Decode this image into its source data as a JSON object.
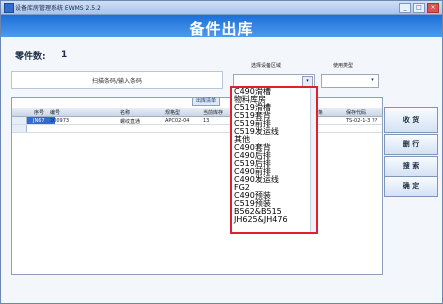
{
  "window": {
    "title": "设备库房管理系统 EWMS 2.5.2",
    "buttons": [
      "_",
      "□",
      "×"
    ]
  },
  "banner": {
    "heading": "备件出库"
  },
  "summary": {
    "label": "零件数:",
    "value": "1"
  },
  "scan": {
    "placeholder": "扫描条码/输入条码"
  },
  "location": {
    "label": "选择设备区域",
    "selected": ""
  },
  "usage_type": {
    "label": "使用类型",
    "selected": ""
  },
  "grid": {
    "tab_label": "出库清单",
    "columns": [
      "序号",
      "编号",
      "名称",
      "规格型",
      "当前库存",
      "条",
      "保存代码"
    ],
    "rows": [
      {
        "index": "JN67",
        "code": "200973",
        "name": "螺纹直通",
        "spec": "APC02-04",
        "stock": "13",
        "code_extra": "TS-02-1-3 ??"
      }
    ]
  },
  "actions": {
    "receive": "收 货",
    "delete": "删 行",
    "search": "搜 索",
    "confirm": "确 定"
  },
  "dropdown": {
    "options": [
      "C490滑槽",
      "物料库房",
      "C519滑槽",
      "C519套背",
      "C519前排",
      "C519发运线",
      "其他",
      "C490套背",
      "C490后排",
      "C519后排",
      "C490前排",
      "C490发运线",
      "FG2",
      "C490预装",
      "C519预装",
      "B562&B515",
      "JH625&JH476"
    ]
  },
  "colors": {
    "banner": "#2f80e0",
    "accent": "#2f6ecf",
    "dropdown_border": "#e0202a"
  }
}
